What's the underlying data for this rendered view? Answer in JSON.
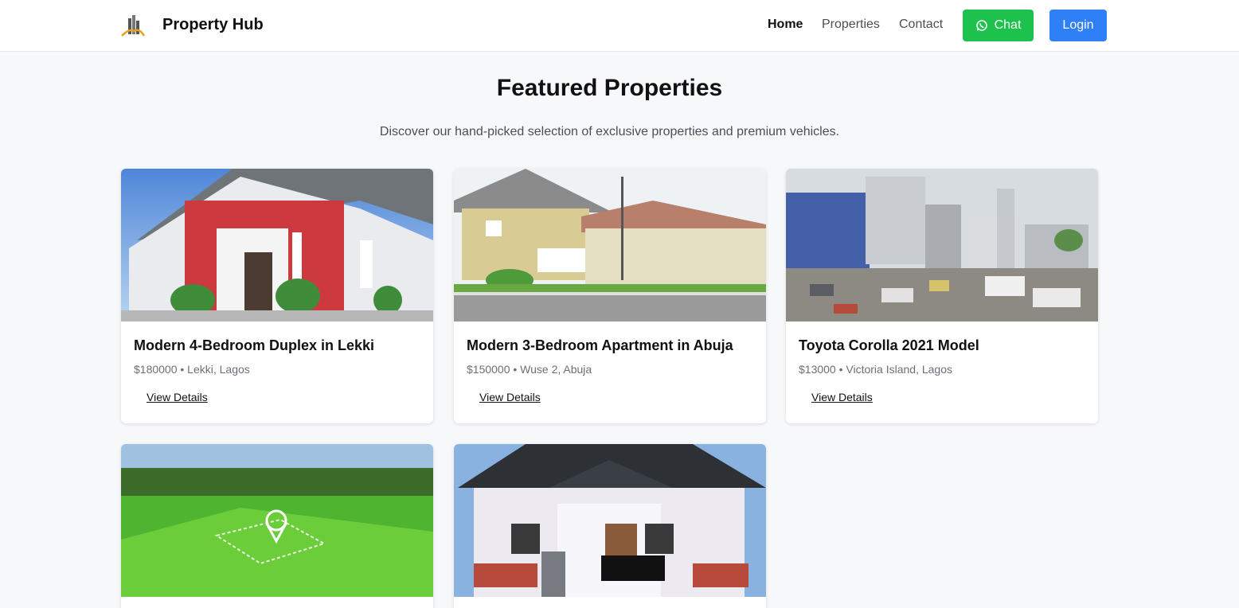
{
  "header": {
    "brand": "Property Hub",
    "nav": [
      "Home",
      "Properties",
      "Contact"
    ],
    "chat_label": "Chat",
    "login_label": "Login"
  },
  "main": {
    "title": "Featured Properties",
    "subtitle": "Discover our hand-picked selection of exclusive properties and premium vehicles.",
    "listings": [
      {
        "title": "Modern 4-Bedroom Duplex in Lekki",
        "meta": "$180000 • Lekki, Lagos",
        "link": "View Details"
      },
      {
        "title": "Modern 3-Bedroom Apartment in Abuja",
        "meta": "$150000 • Wuse 2, Abuja",
        "link": "View Details"
      },
      {
        "title": "Toyota Corolla 2021 Model",
        "meta": "$13000 • Victoria Island, Lagos",
        "link": "View Details"
      },
      {
        "title": "",
        "meta": "",
        "link": ""
      },
      {
        "title": "",
        "meta": "",
        "link": ""
      }
    ]
  },
  "colors": {
    "chat_green": "#1cc24c",
    "login_blue": "#2f80f6",
    "page_bg": "#f7f8fa"
  },
  "icons": [
    "building-logo-icon",
    "whatsapp-icon"
  ]
}
